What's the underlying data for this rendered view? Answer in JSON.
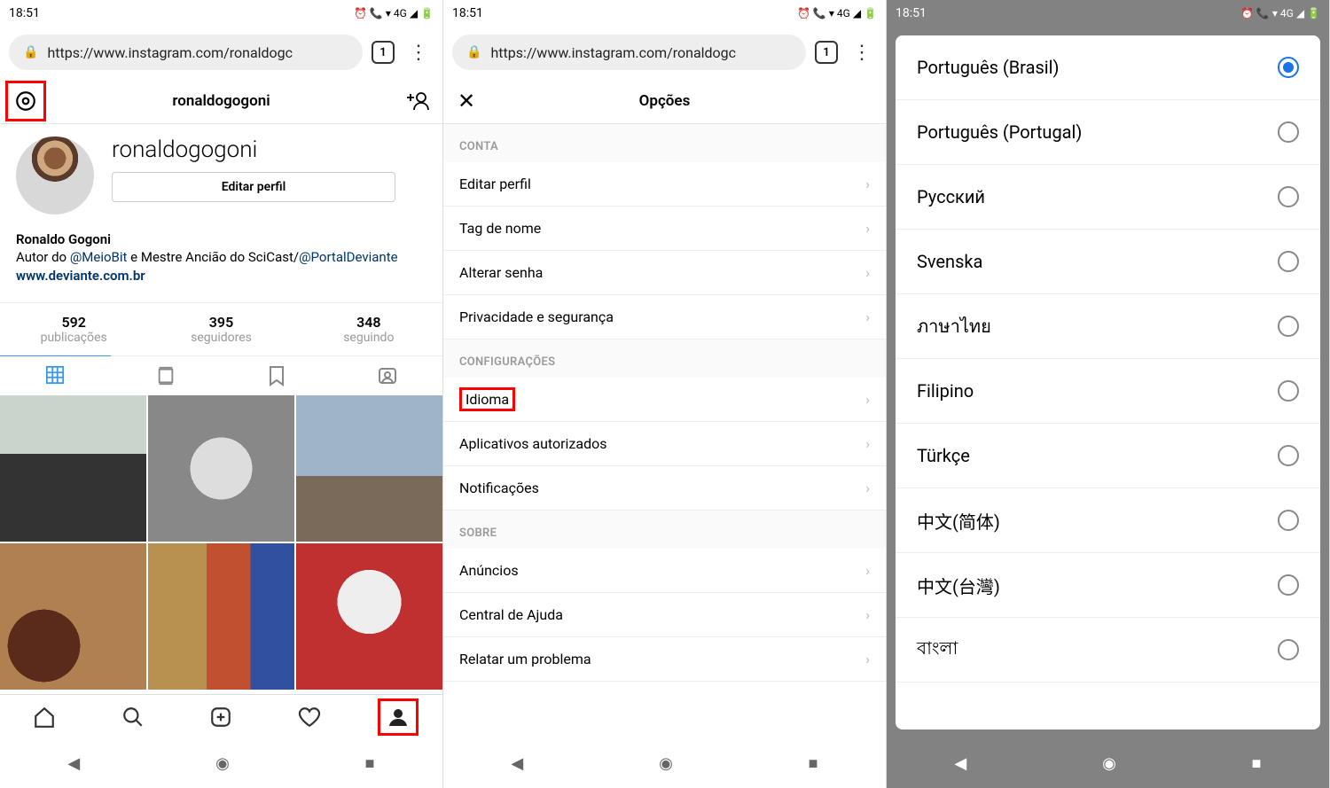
{
  "time": "18:51",
  "status4g": "4G",
  "url": "https://www.instagram.com/ronaldogc",
  "tab_count": "1",
  "profile": {
    "username_header": "ronaldogogoni",
    "display_username": "ronaldogogoni",
    "edit_btn": "Editar perfil",
    "fullname": "Ronaldo Gogoni",
    "bio_prefix": "Autor do ",
    "bio_link1": "@MeioBit",
    "bio_mid": " e Mestre Ancião do SciCast/",
    "bio_link2": "@PortalDeviante",
    "website": "www.deviante.com.br",
    "stats": {
      "posts_n": "592",
      "posts_l": "publicações",
      "followers_n": "395",
      "followers_l": "seguidores",
      "following_n": "348",
      "following_l": "seguindo"
    }
  },
  "options": {
    "title": "Opções",
    "sec_conta": "CONTA",
    "items_conta": {
      "editar": "Editar perfil",
      "tagnome": "Tag de nome",
      "senha": "Alterar senha",
      "privacidade": "Privacidade e segurança"
    },
    "sec_config": "CONFIGURAÇÕES",
    "items_config": {
      "idioma": "Idioma",
      "apps": "Aplicativos autorizados",
      "notif": "Notificações"
    },
    "sec_sobre": "SOBRE",
    "items_sobre": {
      "anuncios": "Anúncios",
      "ajuda": "Central de Ajuda",
      "problema": "Relatar um problema"
    }
  },
  "languages": [
    "Português (Brasil)",
    "Português (Portugal)",
    "Русский",
    "Svenska",
    "ภาษาไทย",
    "Filipino",
    "Türkçe",
    "中文(简体)",
    "中文(台灣)",
    "বাংলা"
  ]
}
